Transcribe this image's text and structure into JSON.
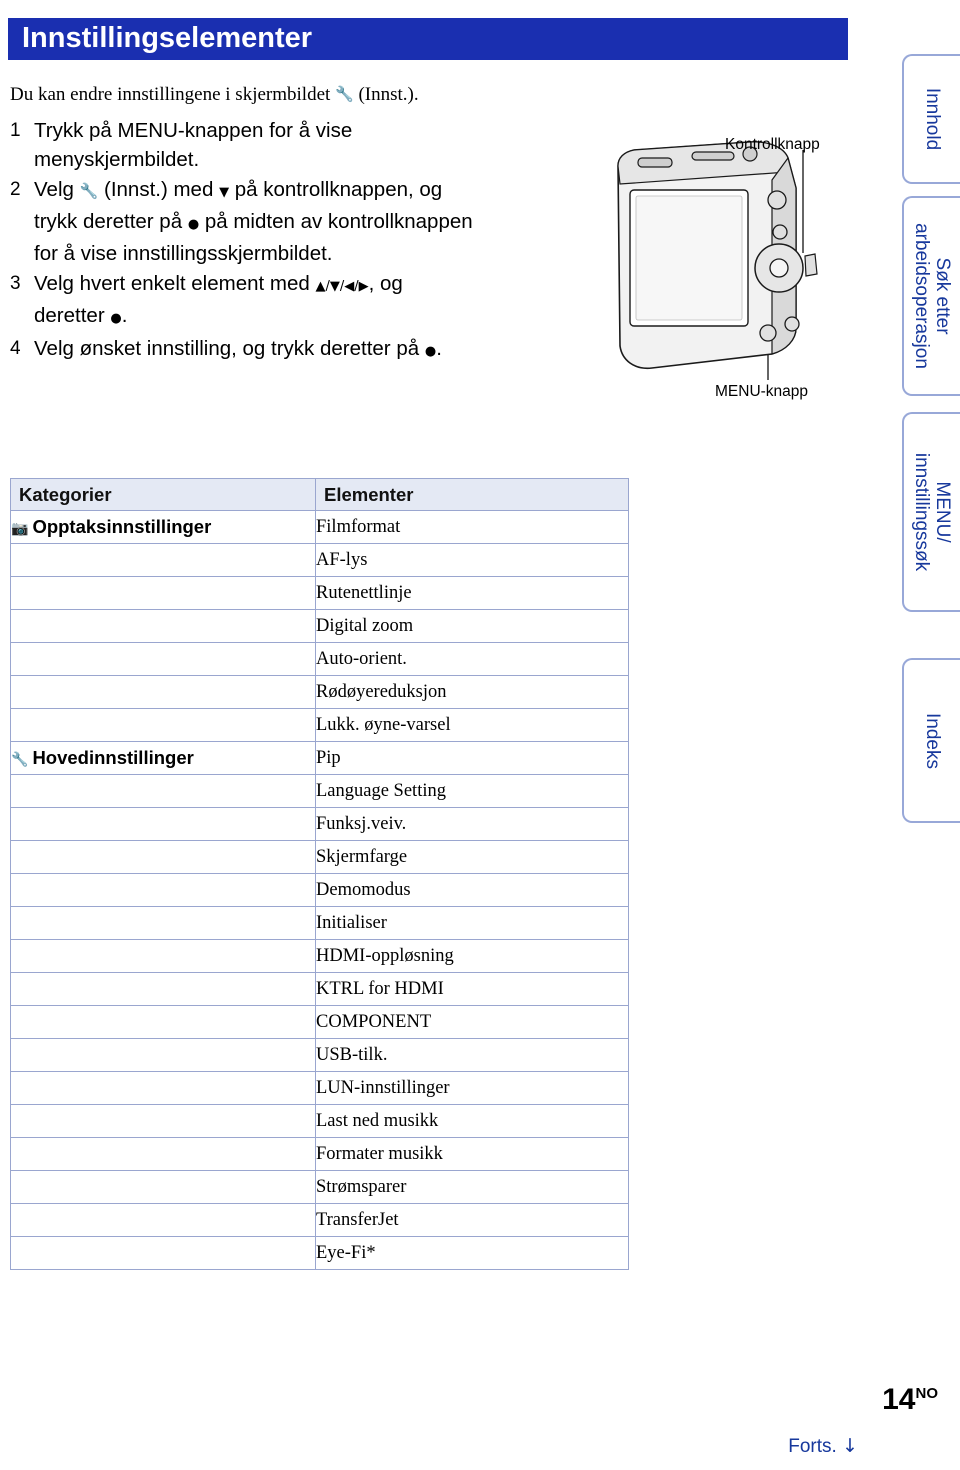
{
  "header": {
    "title": "Innstillingselementer",
    "bar_color": "#1a2fb0"
  },
  "intro": {
    "before": "Du kan endre innstillingene i skjermbildet ",
    "icon": "wrench-icon",
    "icon_glyph": "⚙",
    "after": " (Innst.)."
  },
  "steps": [
    {
      "num": "1",
      "lines": [
        "Trykk på MENU-knappen for å vise",
        "menyskjermbildet."
      ]
    },
    {
      "num": "2",
      "lines": [
        "Velg  (Innst.) med ▼ på kontrollknappen, og",
        "trykk deretter på ● på midten av kontrollknappen",
        "for å vise innstillingsskjermbildet."
      ]
    },
    {
      "num": "3",
      "lines": [
        "Velg hvert enkelt element med ▲/▼/◀/▶, og",
        "deretter ●."
      ]
    },
    {
      "num": "4",
      "lines": [
        "Velg ønsket innstilling, og trykk deretter på ●."
      ]
    }
  ],
  "camera": {
    "label_top": "Kontrollknapp",
    "label_bottom": "MENU-knapp"
  },
  "side_tabs": [
    {
      "id": "tab-innhold",
      "label": "Innhold"
    },
    {
      "id": "tab-sok",
      "label": "Søk etter\narbeidsoperasjon",
      "line1": "Søk etter",
      "line2": "arbeidsoperasjon"
    },
    {
      "id": "tab-menu",
      "label": "MENU/\ninnstillingssøk",
      "line1": "MENU/",
      "line2": "innstillingssøk"
    },
    {
      "id": "tab-indeks",
      "label": "Indeks"
    }
  ],
  "table": {
    "headers": [
      "Kategorier",
      "Elementer"
    ],
    "categories": [
      {
        "icon": "camera-icon",
        "icon_glyph": "📷",
        "label": "Opptaksinnstillinger",
        "items": [
          "Filmformat",
          "AF-lys",
          "Rutenettlinje",
          "Digital zoom",
          "Auto-orient.",
          "Rødøyereduksjon",
          "Lukk. øyne-varsel"
        ]
      },
      {
        "icon": "toolbox-icon",
        "icon_glyph": "🧰",
        "label": "Hovedinnstillinger",
        "items": [
          "Pip",
          "Language Setting",
          "Funksj.veiv.",
          "Skjermfarge",
          "Demomodus",
          "Initialiser",
          "HDMI-oppløsning",
          "KTRL for HDMI",
          "COMPONENT",
          "USB-tilk.",
          "LUN-innstillinger",
          "Last ned musikk",
          "Formater musikk",
          "Strømsparer",
          "TransferJet",
          "Eye-Fi*"
        ]
      }
    ]
  },
  "footer": {
    "page_number": "14",
    "page_suffix": "NO",
    "continue_label": "Forts.",
    "continue_arrow": "↓"
  }
}
